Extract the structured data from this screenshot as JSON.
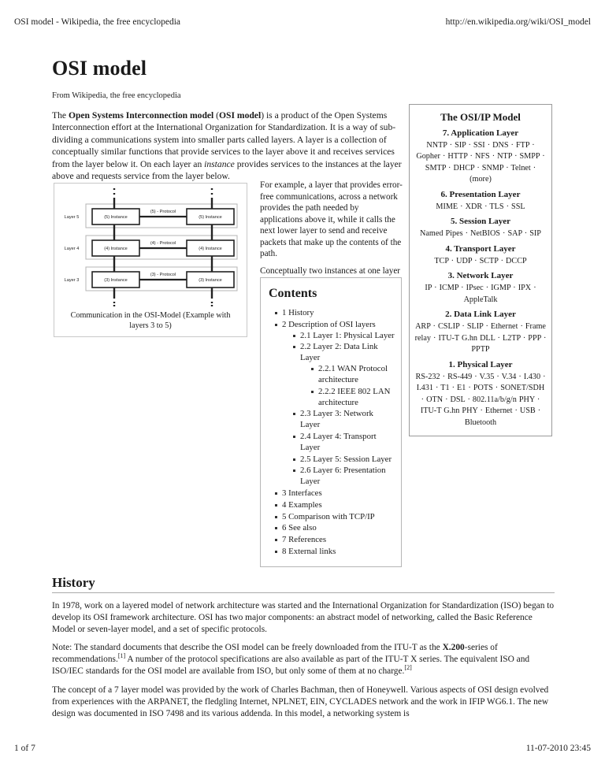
{
  "header": {
    "doc_title": "OSI model - Wikipedia, the free encyclopedia",
    "url": "http://en.wikipedia.org/wiki/OSI_model"
  },
  "footer": {
    "page_indicator": "1 of 7",
    "timestamp": "11-07-2010 23:45"
  },
  "article": {
    "title": "OSI model",
    "tagline": "From Wikipedia, the free encyclopedia",
    "lead_html": "The <b>Open Systems Interconnection model</b> (<b>OSI model</b>) is a product of the Open Systems Interconnection effort at the International Organization for Standardization. It is a way of sub-dividing a communications system into smaller parts called layers. A layer is a collection of conceptually similar functions that provide services to the layer above it and receives services from the layer below it. On each layer an <i>instance</i> provides services to the instances at the layer above and requests service from the layer below.",
    "mid_paragraphs": [
      "For example, a layer that provides error-free communications, across a network provides the path needed by applications above it, while it calls the next lower layer to send and receive packets that make up the contents of the path.",
      "Conceptually two instances at one layer are connected by a horizontal protocol connection on that layer."
    ]
  },
  "figure": {
    "caption": "Communication in the OSI-Model (Example with layers 3 to 5)",
    "layers": [
      {
        "layer_label": "Layer 5",
        "instance_left": "(5) Instance",
        "protocol_label": "(5) - Protocol",
        "instance_right": "(5) Instance"
      },
      {
        "layer_label": "Layer 4",
        "instance_left": "(4) Instance",
        "protocol_label": "(4) - Protocol",
        "instance_right": "(4) Instance"
      },
      {
        "layer_label": "Layer 3",
        "instance_left": "(3) Instance",
        "protocol_label": "(3) - Protocol",
        "instance_right": "(3) Instance"
      }
    ]
  },
  "infobox": {
    "title": "The OSI/IP Model",
    "layers": [
      {
        "name": "7. Application Layer",
        "protocols": "NNTP · SIP · SSI · DNS · FTP · Gopher · HTTP · NFS · NTP · SMPP · SMTP · DHCP · SNMP · Telnet · (more)"
      },
      {
        "name": "6. Presentation Layer",
        "protocols": "MIME · XDR · TLS · SSL"
      },
      {
        "name": "5. Session Layer",
        "protocols": "Named Pipes · NetBIOS · SAP · SIP"
      },
      {
        "name": "4. Transport Layer",
        "protocols": "TCP · UDP · SCTP · DCCP"
      },
      {
        "name": "3. Network Layer",
        "protocols": "IP · ICMP · IPsec · IGMP · IPX · AppleTalk"
      },
      {
        "name": "2. Data Link Layer",
        "protocols": "ARP · CSLIP · SLIP · Ethernet · Frame relay · ITU-T G.hn DLL · L2TP · PPP · PPTP"
      },
      {
        "name": "1. Physical Layer",
        "protocols": "RS-232 · RS-449 · V.35 · V.34 · I.430 · I.431 · T1 · E1 · POTS · SONET/SDH · OTN · DSL · 802.11a/b/g/n PHY · ITU-T G.hn PHY · Ethernet · USB · Bluetooth"
      }
    ]
  },
  "toc": {
    "title": "Contents",
    "items": [
      {
        "label": "1 History",
        "children": []
      },
      {
        "label": "2 Description of OSI layers",
        "children": [
          {
            "label": "2.1 Layer 1: Physical Layer",
            "children": []
          },
          {
            "label": "2.2 Layer 2: Data Link Layer",
            "children": [
              {
                "label": "2.2.1 WAN Protocol architecture",
                "children": []
              },
              {
                "label": "2.2.2 IEEE 802 LAN architecture",
                "children": []
              }
            ]
          },
          {
            "label": "2.3 Layer 3: Network Layer",
            "children": []
          },
          {
            "label": "2.4 Layer 4: Transport Layer",
            "children": []
          },
          {
            "label": "2.5 Layer 5: Session Layer",
            "children": []
          },
          {
            "label": "2.6 Layer 6: Presentation Layer",
            "children": []
          }
        ]
      },
      {
        "label": "3 Interfaces",
        "children": []
      },
      {
        "label": "4 Examples",
        "children": []
      },
      {
        "label": "5 Comparison with TCP/IP",
        "children": []
      },
      {
        "label": "6 See also",
        "children": []
      },
      {
        "label": "7 References",
        "children": []
      },
      {
        "label": "8 External links",
        "children": []
      }
    ]
  },
  "history": {
    "heading": "History",
    "paragraphs_html": [
      "In 1978, work on a layered model of network architecture was started and the International Organization for Standardization (ISO) began to develop its OSI framework architecture. OSI has two major components: an abstract model of networking, called the Basic Reference Model or seven-layer model, and a set of specific protocols.",
      "Note: The standard documents that describe the OSI model can be freely downloaded from the ITU-T as the <b>X.200</b>-series of recommendations.<sup>[1]</sup> A number of the protocol specifications are also available as part of the ITU-T X series. The equivalent ISO and ISO/IEC standards for the OSI model are available from ISO, but only some of them at no charge.<sup>[2]</sup>",
      "The concept of a 7 layer model was provided by the work of Charles Bachman, then of Honeywell. Various aspects of OSI design evolved from experiences with the ARPANET, the fledgling Internet, NPLNET, EIN, CYCLADES network and the work in IFIP WG6.1. The new design was documented in ISO 7498 and its various addenda. In this model, a networking system is"
    ]
  }
}
